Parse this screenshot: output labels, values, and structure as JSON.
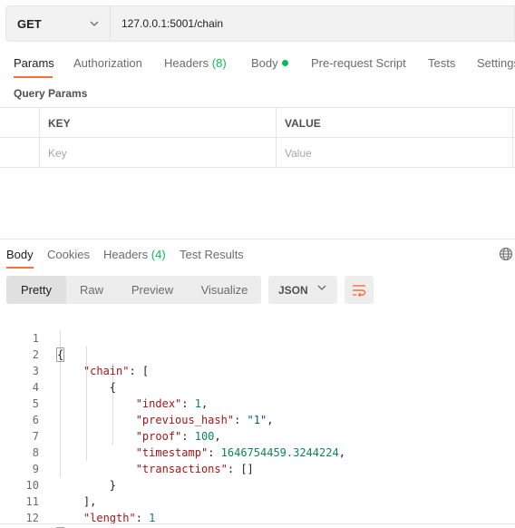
{
  "request": {
    "method": "GET",
    "url": "127.0.0.1:5001/chain"
  },
  "request_tabs": {
    "params": "Params",
    "authorization": "Authorization",
    "headers": "Headers",
    "headers_count": "(8)",
    "body": "Body",
    "pre_request_script": "Pre-request Script",
    "tests": "Tests",
    "settings": "Settings"
  },
  "query_params": {
    "title": "Query Params",
    "columns": [
      "KEY",
      "VALUE"
    ],
    "placeholders": [
      "Key",
      "Value"
    ]
  },
  "response_tabs": {
    "body": "Body",
    "cookies": "Cookies",
    "headers": "Headers",
    "headers_count": "(4)",
    "test_results": "Test Results"
  },
  "response_view": {
    "modes": [
      "Pretty",
      "Raw",
      "Preview",
      "Visualize"
    ],
    "active_mode": "Pretty",
    "format": "JSON"
  },
  "response_body": {
    "line_numbers": [
      "1",
      "2",
      "3",
      "4",
      "5",
      "6",
      "7",
      "8",
      "9",
      "10",
      "11",
      "12"
    ],
    "chain_key": "\"chain\"",
    "index_key": "\"index\"",
    "index_value": "1",
    "previous_hash_key": "\"previous_hash\"",
    "previous_hash_value": "\"1\"",
    "proof_key": "\"proof\"",
    "proof_value": "100",
    "timestamp_key": "\"timestamp\"",
    "timestamp_value": "1646754459.3244224",
    "transactions_key": "\"transactions\"",
    "transactions_value": "[]",
    "length_key": "\"length\"",
    "length_value": "1"
  },
  "colors": {
    "accent": "#ff6c37",
    "success": "#0cbb52",
    "json_key": "#a31515",
    "json_string": "#0451a5",
    "json_number": "#098658"
  },
  "icons": [
    "chevron-down-icon",
    "globe-icon",
    "wrap-lines-icon"
  ]
}
